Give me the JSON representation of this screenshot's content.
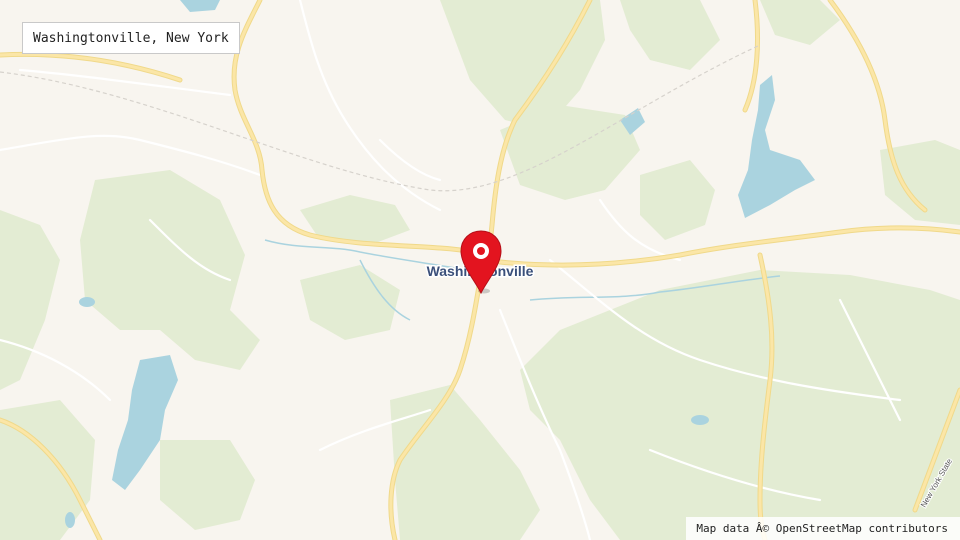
{
  "search": {
    "query": "Washingtonville, New York"
  },
  "map": {
    "place_label": "Washingtonville",
    "road_label": "New York State",
    "colors": {
      "land": "#f8f5ef",
      "forest": "#e3ecd3",
      "water": "#aad3df",
      "road_major": "#fbe6a7",
      "road_major_casing": "#f0d98a",
      "road_minor": "#ffffff",
      "place_label": "#3a4f7a",
      "marker": "#e3141f"
    },
    "marker_icon": "map-pin-icon"
  },
  "attribution": {
    "text": "Map data Â© OpenStreetMap contributors"
  }
}
